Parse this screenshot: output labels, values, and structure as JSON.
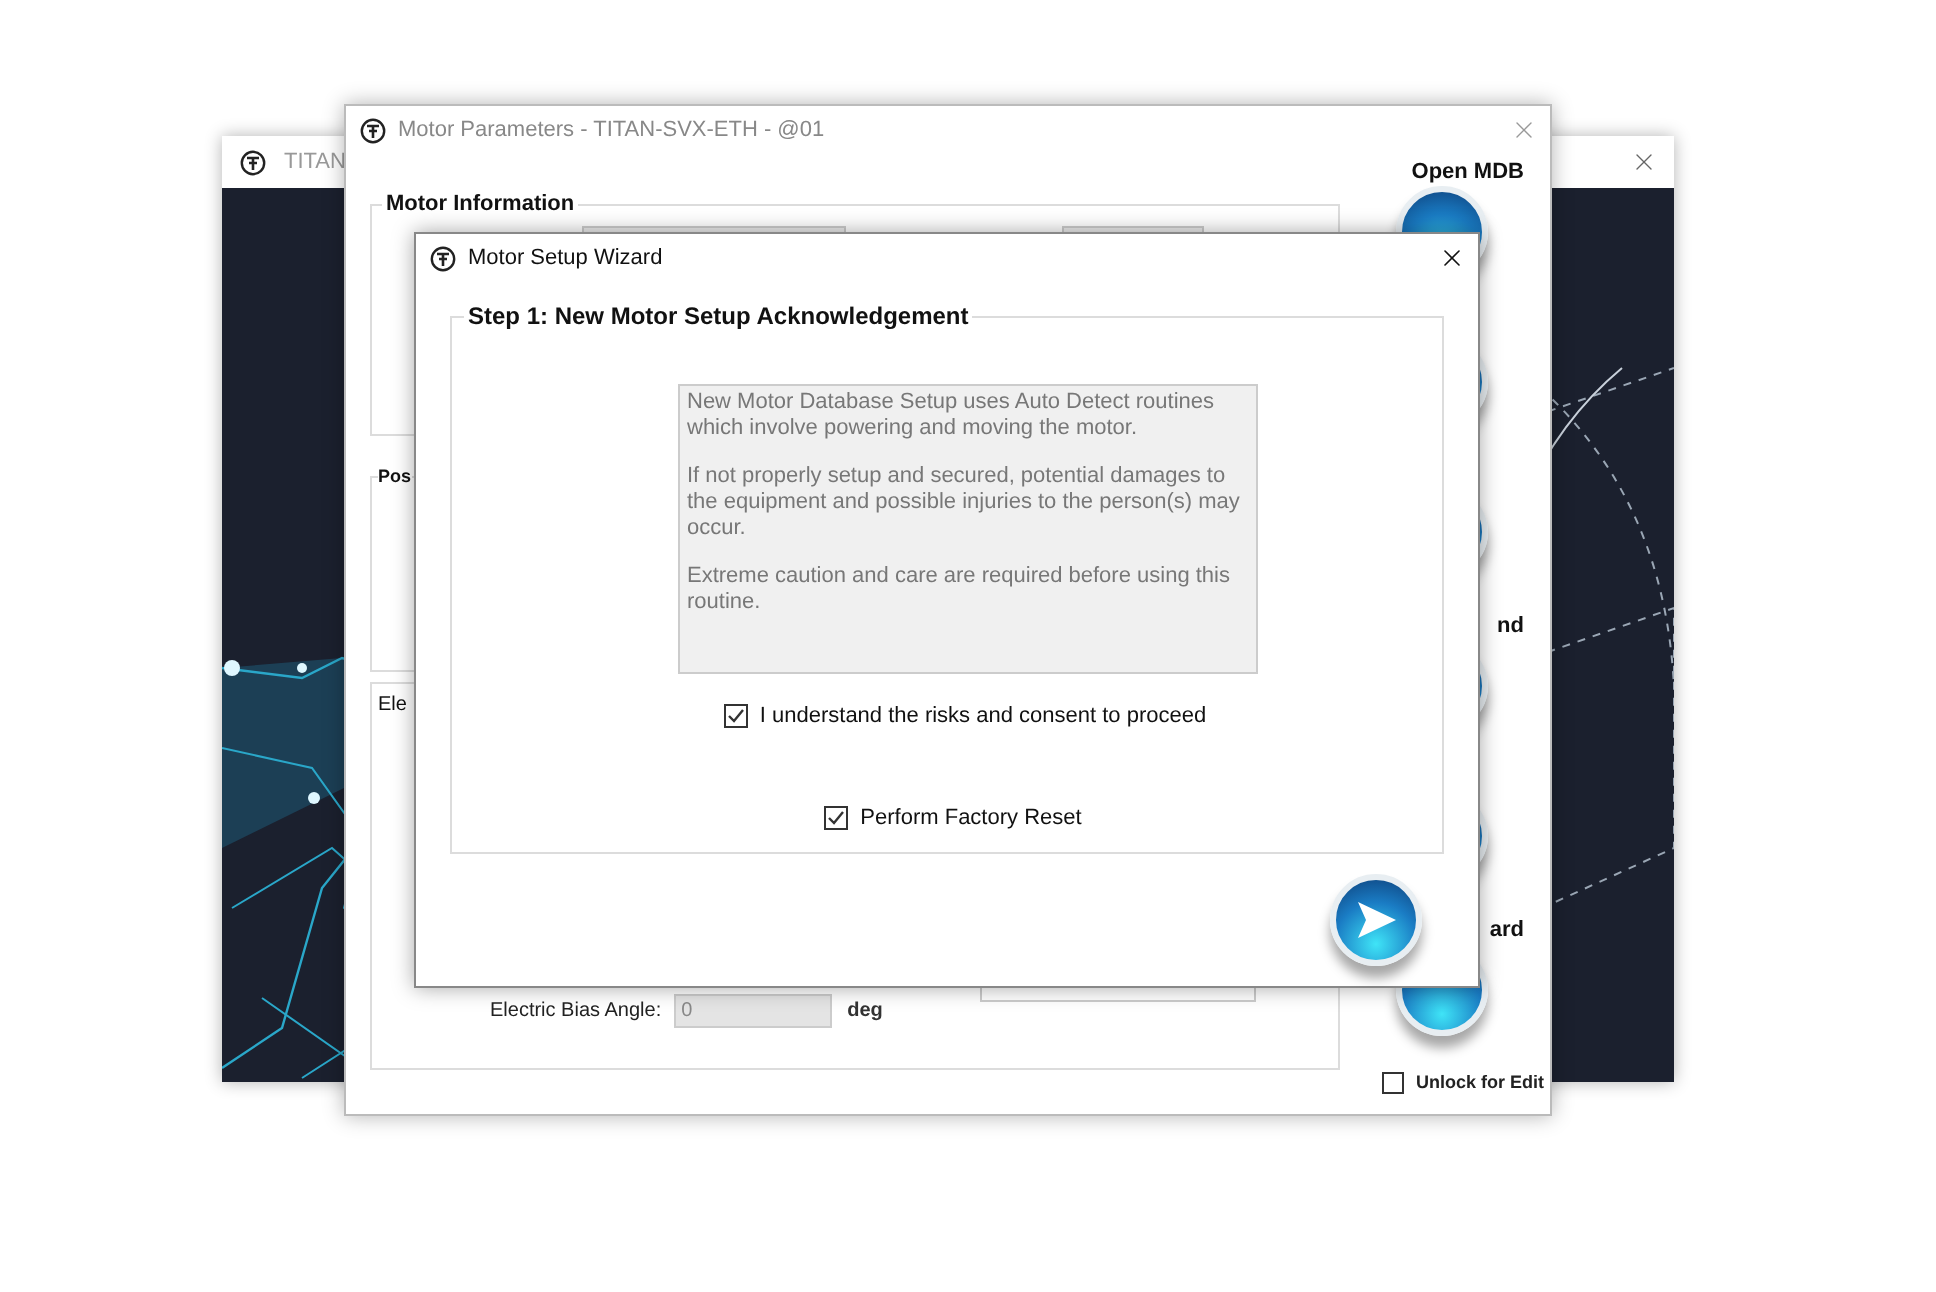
{
  "background_window": {
    "title": "TITAN"
  },
  "motor_parameters": {
    "title": "Motor Parameters - TITAN-SVX-ETH - @01",
    "groups": [
      {
        "title": "Motor Information"
      },
      {
        "title": "Pos"
      },
      {
        "title": "Ele"
      }
    ],
    "electric_bias_angle": {
      "label": "Electric Bias Angle:",
      "value": "0",
      "unit": "deg"
    },
    "side_panel": [
      {
        "kind": "label",
        "text": "Open MDB"
      },
      {
        "kind": "button"
      },
      {
        "kind": "button"
      },
      {
        "kind": "button"
      },
      {
        "kind": "label",
        "text": "nd"
      },
      {
        "kind": "button"
      },
      {
        "kind": "button"
      },
      {
        "kind": "label",
        "text": "ard"
      },
      {
        "kind": "button"
      }
    ],
    "unlock_for_edit": {
      "label": "Unlock for Edit",
      "checked": false
    }
  },
  "wizard": {
    "title": "Motor Setup Wizard",
    "step_title": "Step 1: New Motor Setup Acknowledgement",
    "message": [
      "New Motor Database Setup uses Auto Detect routines which involve powering and moving the motor.",
      "If not properly setup and secured, potential damages to the equipment and possible injuries to the person(s) may occur.",
      "Extreme caution and care are required before using this routine."
    ],
    "checkboxes": [
      {
        "label": "I understand the risks and consent to proceed",
        "checked": true
      },
      {
        "label": "Perform Factory Reset",
        "checked": true
      }
    ]
  }
}
